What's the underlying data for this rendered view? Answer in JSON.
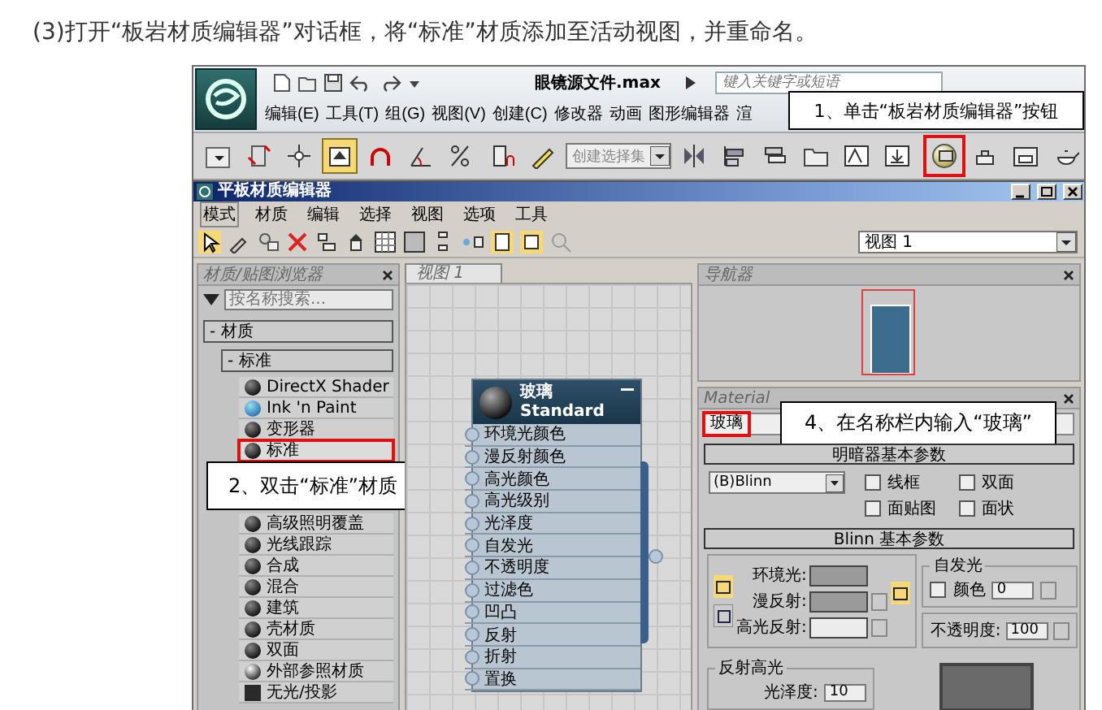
{
  "instruction": "(3)打开“板岩材质编辑器”对话框，将“标准”材质添加至活动视图，并重命名。",
  "app": {
    "file_title": "眼镜源文件.max",
    "search_placeholder": "键入关键字或短语",
    "menus": [
      "编辑(E)",
      "工具(T)",
      "组(G)",
      "视图(V)",
      "创建(C)",
      "修改器",
      "动画",
      "图形编辑器",
      "渲"
    ],
    "selection_set": "创建选择集",
    "toolbar": [
      {
        "kind": "combo",
        "active": false,
        "highlighted": false
      },
      {
        "kind": "link",
        "active": false,
        "highlighted": false
      },
      {
        "kind": "move",
        "active": false,
        "highlighted": false
      },
      {
        "kind": "select",
        "active": true,
        "highlighted": false
      },
      {
        "kind": "snap",
        "active": false,
        "highlighted": false
      },
      {
        "kind": "angle",
        "active": false,
        "highlighted": false
      },
      {
        "kind": "percent",
        "active": false,
        "highlighted": false
      },
      {
        "kind": "spinner",
        "active": false,
        "highlighted": false
      },
      {
        "kind": "edit-set",
        "active": false,
        "highlighted": false
      },
      {
        "kind": "set-field",
        "active": false,
        "highlighted": false
      },
      {
        "kind": "mirror",
        "active": false,
        "highlighted": false
      },
      {
        "kind": "align",
        "active": false,
        "highlighted": false
      },
      {
        "kind": "layers",
        "active": false,
        "highlighted": false
      },
      {
        "kind": "folder",
        "active": false,
        "highlighted": false
      },
      {
        "kind": "curve",
        "active": false,
        "highlighted": false
      },
      {
        "kind": "dope",
        "active": false,
        "highlighted": false
      },
      {
        "kind": "material",
        "active": false,
        "highlighted": true
      },
      {
        "kind": "teapot-setup",
        "active": false,
        "highlighted": false
      },
      {
        "kind": "teapot-frame",
        "active": false,
        "highlighted": false
      },
      {
        "kind": "teapot",
        "active": false,
        "highlighted": false
      }
    ],
    "callout": "1、单击“板岩材质编辑器”按钮"
  },
  "editor": {
    "title": "平板材质编辑器",
    "menus": [
      {
        "label": "模式",
        "selected": true
      },
      {
        "label": "材质",
        "selected": false
      },
      {
        "label": "编辑",
        "selected": false
      },
      {
        "label": "选择",
        "selected": false
      },
      {
        "label": "视图",
        "selected": false
      },
      {
        "label": "选项",
        "selected": false
      },
      {
        "label": "工具",
        "selected": false
      }
    ],
    "view_select": "视图 1",
    "browser": {
      "title": "材质/贴图浏览器",
      "search_placeholder": "按名称搜索...",
      "group": "- 材质",
      "subgroup": "- 标准",
      "items": [
        {
          "label": "DirectX Shader",
          "kind": "sphere",
          "highlighted": false
        },
        {
          "label": "Ink 'n Paint",
          "kind": "ink",
          "highlighted": false
        },
        {
          "label": "变形器",
          "kind": "sphere",
          "highlighted": false
        },
        {
          "label": "标准",
          "kind": "sphere",
          "highlighted": true
        },
        {
          "label": "高级照明覆盖",
          "kind": "sphere",
          "highlighted": false
        },
        {
          "label": "光线跟踪",
          "kind": "sphere",
          "highlighted": false
        },
        {
          "label": "合成",
          "kind": "sphere",
          "highlighted": false
        },
        {
          "label": "混合",
          "kind": "sphere",
          "highlighted": false
        },
        {
          "label": "建筑",
          "kind": "sphere",
          "highlighted": false
        },
        {
          "label": "壳材质",
          "kind": "sphere",
          "highlighted": false
        },
        {
          "label": "双面",
          "kind": "sphere",
          "highlighted": false
        },
        {
          "label": "外部参照材质",
          "kind": "chrome",
          "highlighted": false
        },
        {
          "label": "无光/投影",
          "kind": "flat",
          "highlighted": false
        }
      ],
      "callout": "2、双击“标准”材质"
    },
    "view": {
      "tab": "视图 1",
      "node": {
        "name": "玻璃",
        "type": "Standard",
        "slots": [
          "环境光颜色",
          "漫反射颜色",
          "高光颜色",
          "高光级别",
          "光泽度",
          "自发光",
          "不透明度",
          "过滤色",
          "凹凸",
          "反射",
          "折射",
          "置换"
        ]
      }
    },
    "navigator": {
      "title": "导航器"
    },
    "material": {
      "title": "Material",
      "name": "玻璃",
      "name_highlighted": true,
      "callout": "4、在名称栏内输入“玻璃”",
      "shader_rollout": "明暗器基本参数",
      "shader": "(B)Blinn",
      "options": [
        {
          "label": "线框",
          "checked": false
        },
        {
          "label": "双面",
          "checked": false
        },
        {
          "label": "面贴图",
          "checked": false
        },
        {
          "label": "面状",
          "checked": false
        }
      ],
      "basic_rollout": "Blinn 基本参数",
      "colors": [
        {
          "label": "环境光:",
          "color": "#9a9a9a"
        },
        {
          "label": "漫反射:",
          "color": "#9a9a9a"
        },
        {
          "label": "高光反射:",
          "color": "#ececec"
        }
      ],
      "self_illum": {
        "title": "自发光",
        "label": "颜色",
        "checked": false,
        "value": "0"
      },
      "opacity": {
        "label": "不透明度:",
        "value": "100"
      },
      "highlights": {
        "title": "反射高光",
        "gloss_label": "光泽度:",
        "gloss_value": "10"
      }
    }
  }
}
